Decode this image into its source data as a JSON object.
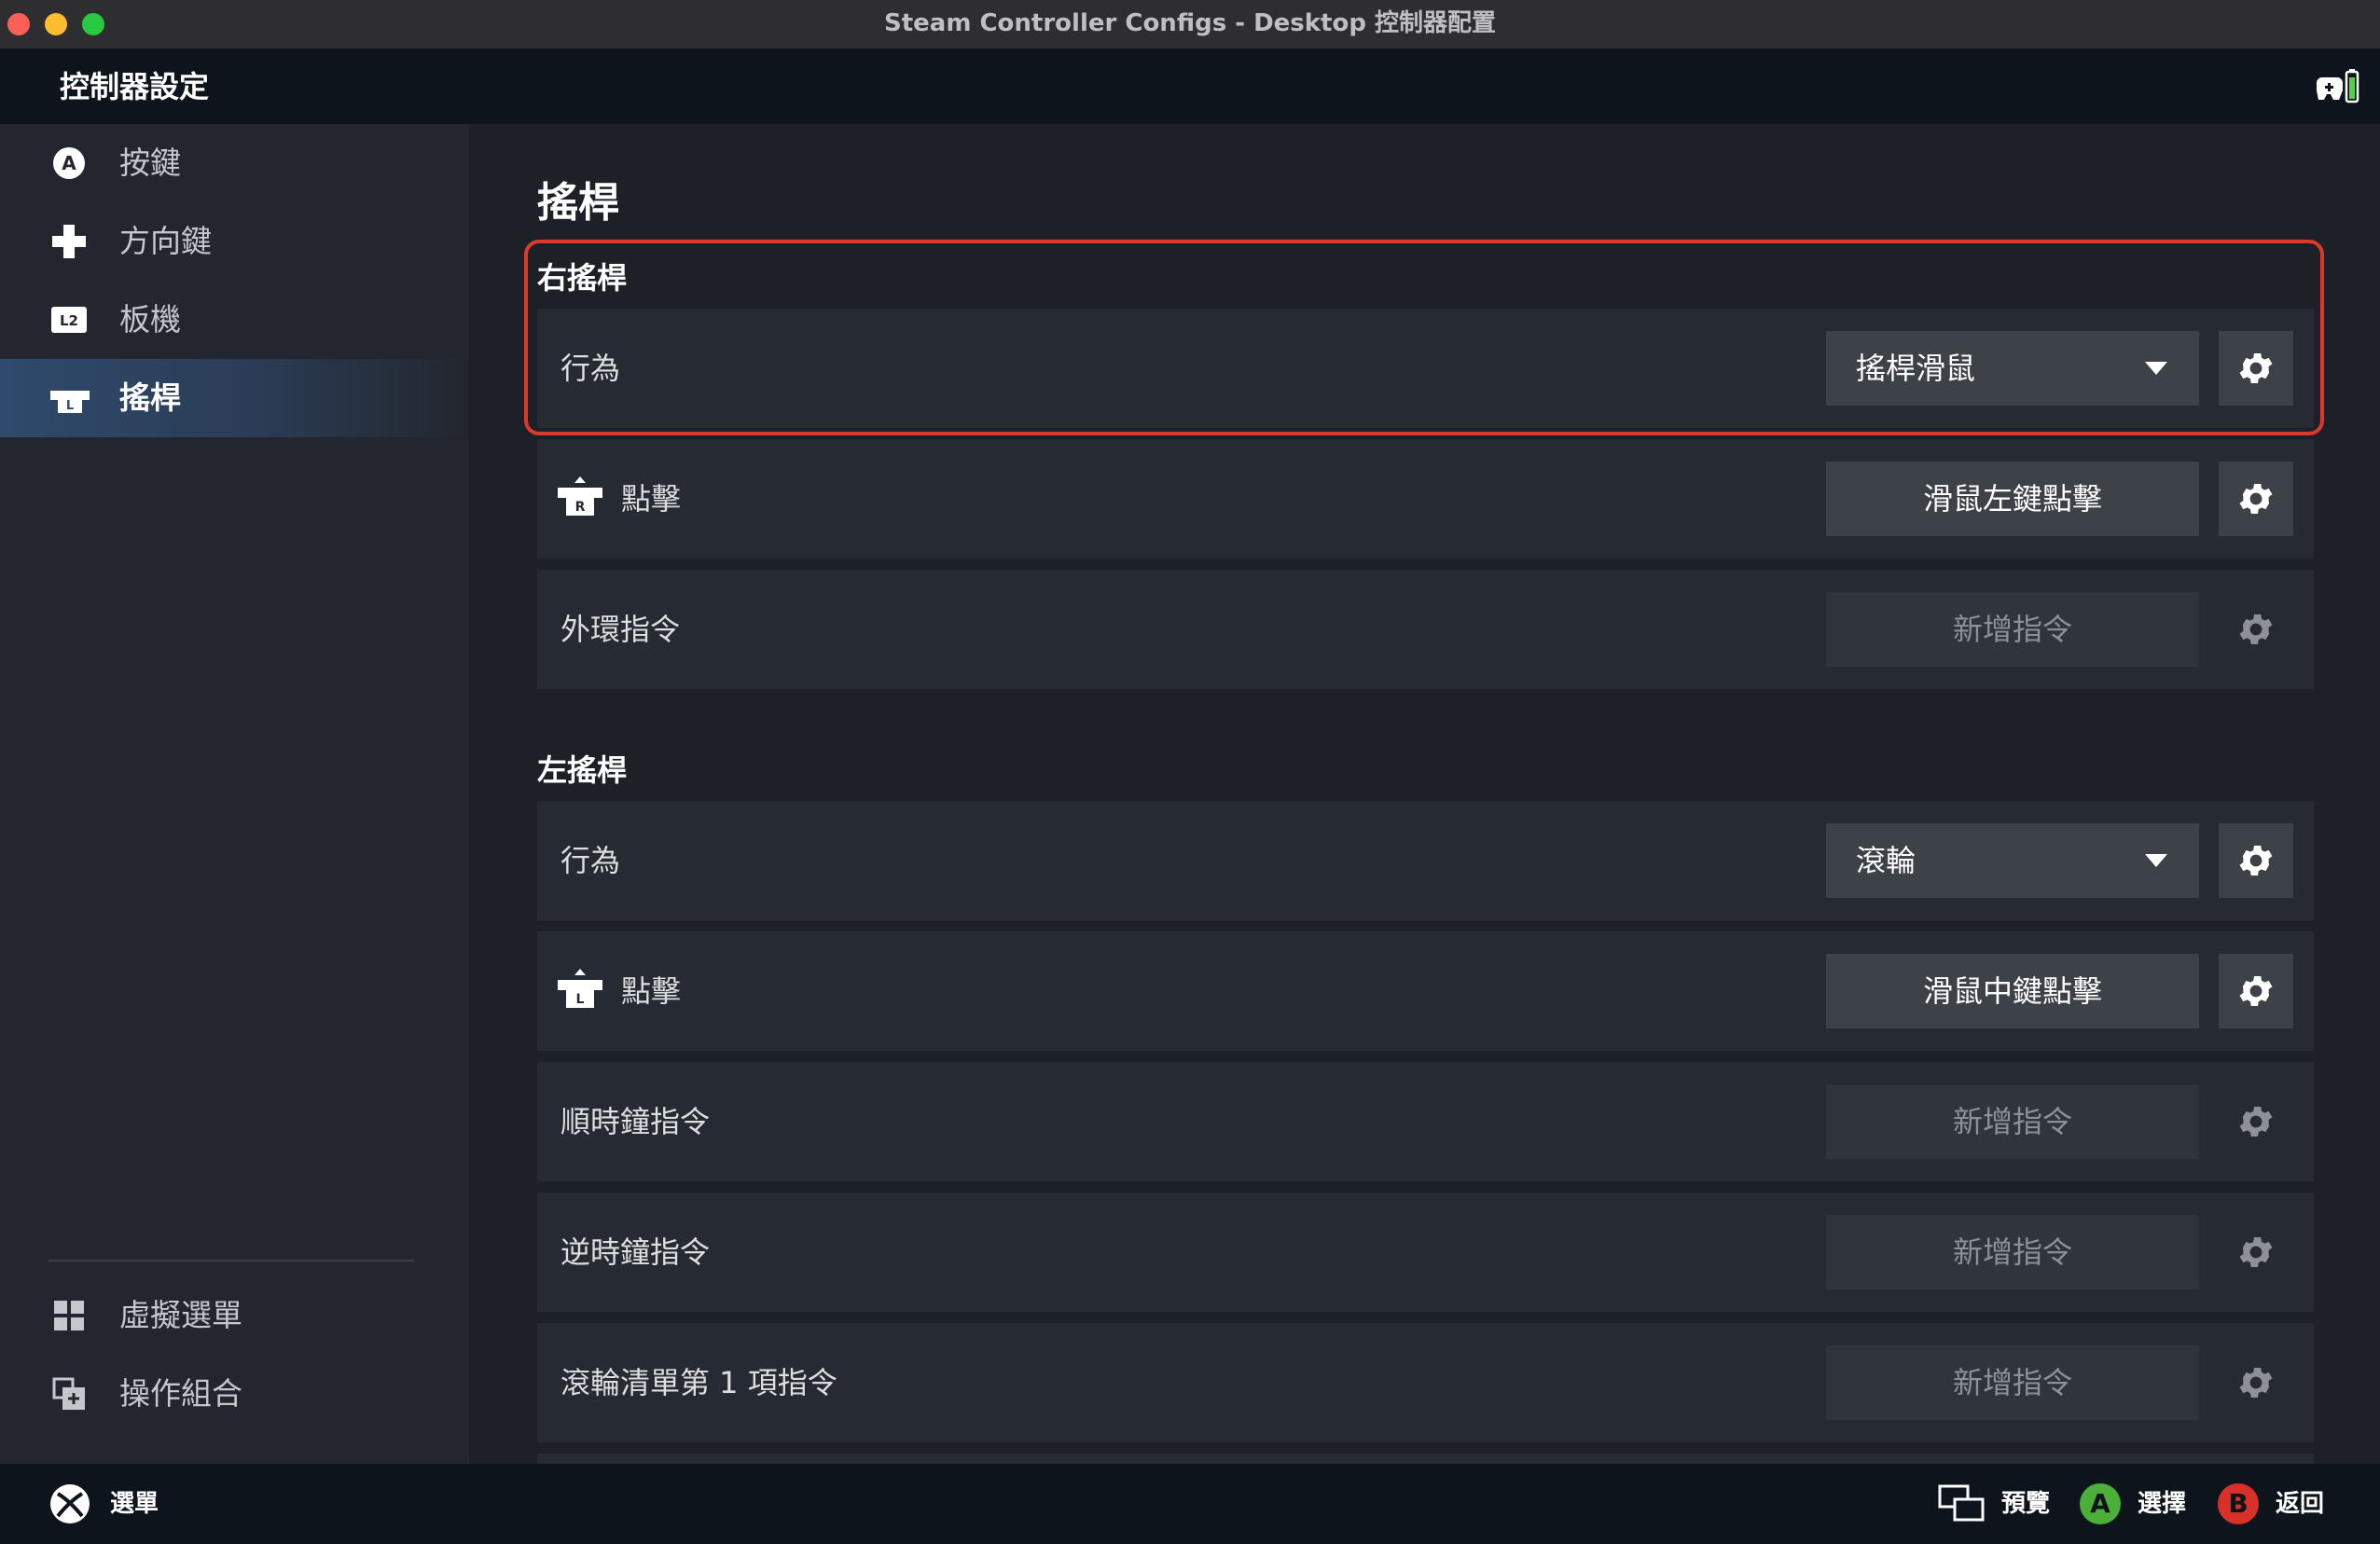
{
  "window": {
    "title": "Steam Controller Configs - Desktop 控制器配置"
  },
  "header": {
    "title": "控制器設定",
    "status_icon": "controller-battery-icon"
  },
  "sidebar": {
    "items": [
      {
        "label": "按鍵",
        "icon": "a-button-icon"
      },
      {
        "label": "方向鍵",
        "icon": "dpad-icon"
      },
      {
        "label": "板機",
        "icon": "l2-trigger-icon"
      },
      {
        "label": "搖桿",
        "icon": "joystick-icon",
        "active": true
      }
    ],
    "bottom_items": [
      {
        "label": "虛擬選單",
        "icon": "grid-icon"
      },
      {
        "label": "操作組合",
        "icon": "action-set-icon"
      }
    ]
  },
  "main": {
    "page_title": "搖桿",
    "right_stick": {
      "title": "右搖桿",
      "behavior": {
        "label": "行為",
        "value": "搖桿滑鼠"
      },
      "click": {
        "label": "點擊",
        "value": "滑鼠左鍵點擊"
      },
      "outer_ring": {
        "label": "外環指令",
        "value": "新增指令"
      }
    },
    "left_stick": {
      "title": "左搖桿",
      "behavior": {
        "label": "行為",
        "value": "滾輪"
      },
      "click": {
        "label": "點擊",
        "value": "滑鼠中鍵點擊"
      },
      "clockwise": {
        "label": "順時鐘指令",
        "value": "新增指令"
      },
      "counterclockwise": {
        "label": "逆時鐘指令",
        "value": "新增指令"
      },
      "scroll_item_1": {
        "label": "滾輪清單第 1 項指令",
        "value": "新增指令"
      }
    }
  },
  "footer": {
    "menu_label": "選單",
    "preview_label": "預覽",
    "select_label": "選擇",
    "select_badge": "A",
    "back_label": "返回",
    "back_badge": "B"
  },
  "colors": {
    "accent_highlight": "#d93a2c",
    "active_nav": "#2f4a6c",
    "a_badge": "#4caf39",
    "b_badge": "#d9302a"
  }
}
